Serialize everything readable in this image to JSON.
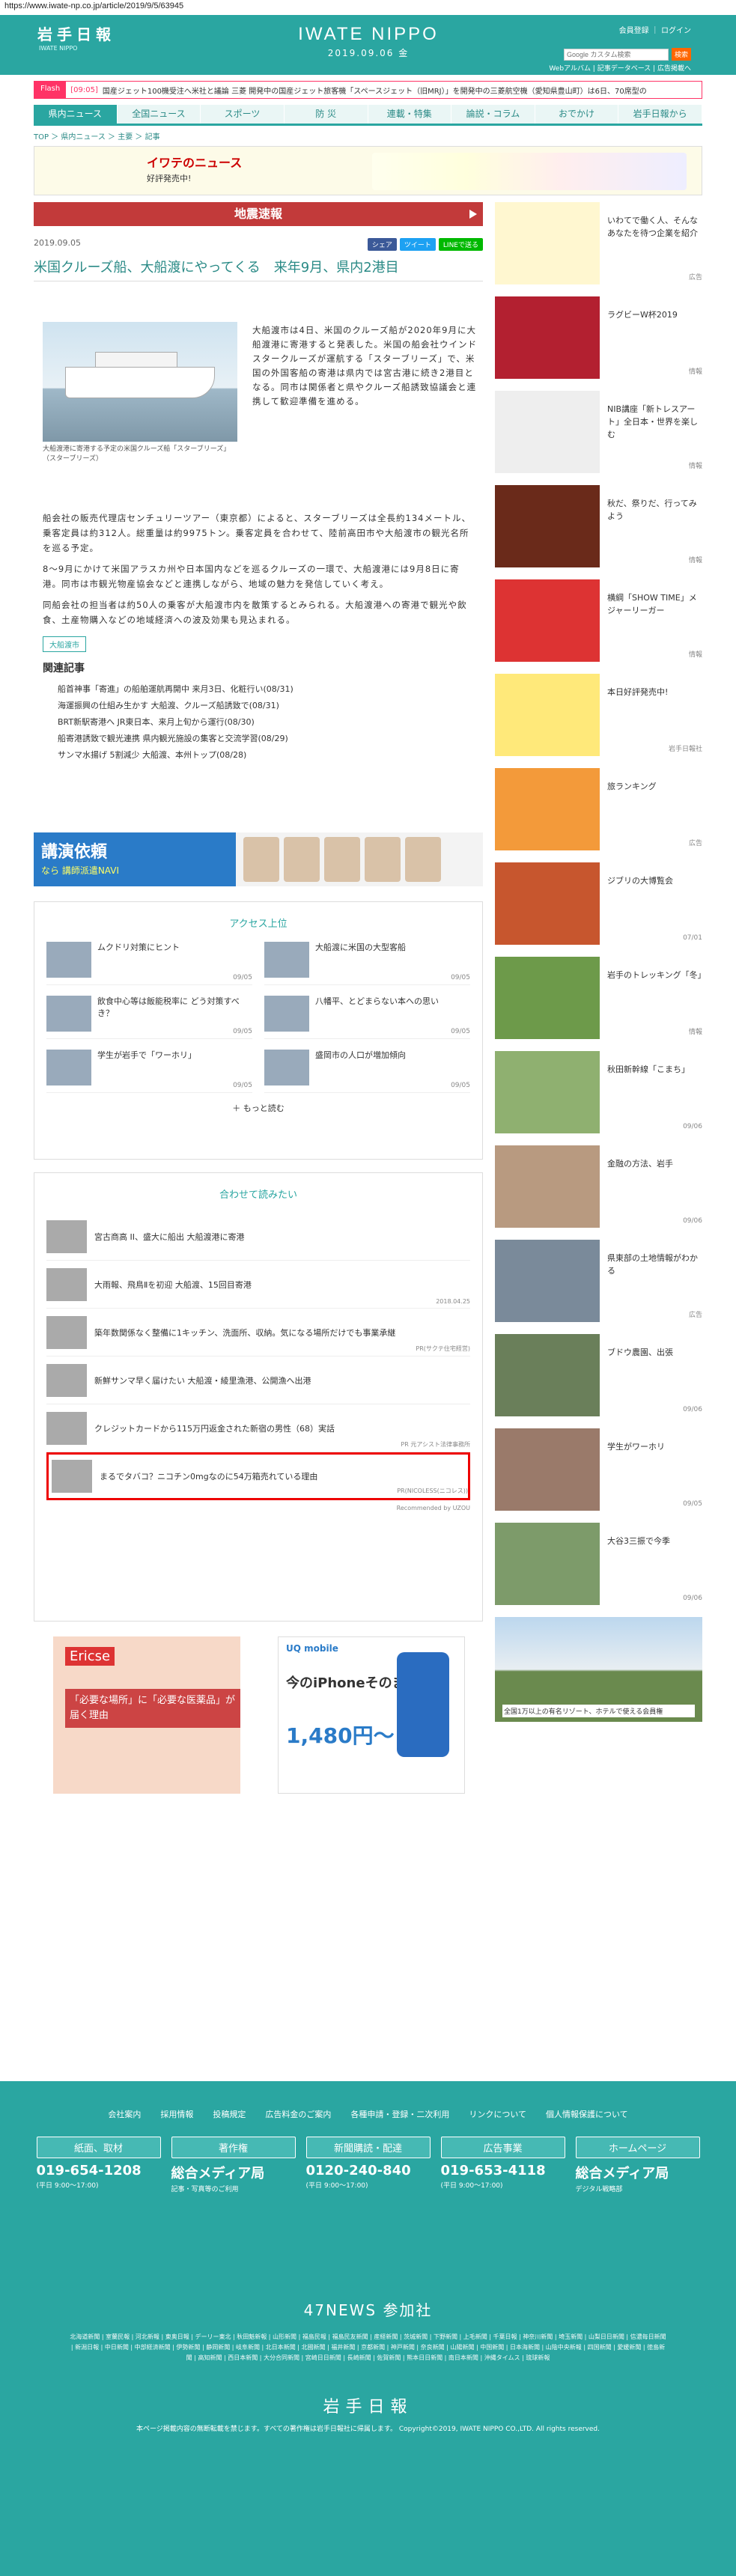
{
  "url": "https://www.iwate-np.co.jp/article/2019/9/5/63945",
  "header": {
    "logo": "岩手日報",
    "logo_sub": "IWATE NIPPO",
    "brand": "IWATE NIPPO",
    "date": "2019.09.06 金",
    "member_link": "会員登録",
    "login_link": "ログイン",
    "search_placeholder": "Google カスタム検索",
    "search_btn": "検索",
    "sub_links": "Webアルバム | 記事データベース | 広告掲載へ"
  },
  "flash": {
    "tag": "Flash",
    "time": "[09:05]",
    "text": "国産ジェット100機受注へ米社と議論 三菱 開発中の国産ジェット旅客機「スペースジェット（旧MRJ）」を開発中の三菱航空機（愛知県豊山町）は6日、70席型の"
  },
  "nav": [
    "県内ニュース",
    "全国ニュース",
    "スポーツ",
    "防 災",
    "連載・特集",
    "論説・コラム",
    "おでかけ",
    "岩手日報から"
  ],
  "breadcrumb": "TOP ＞ 県内ニュース ＞ 主要 ＞ 記事",
  "promo": {
    "title": "イワテのニュース",
    "sub": "好評発売中!"
  },
  "quake": "地震速報",
  "article": {
    "date": "2019.09.05",
    "share": "シェア",
    "tweet": "ツイート",
    "line": "LINEで送る",
    "title": "米国クルーズ船、大船渡にやってくる　来年9月、県内2港目",
    "caption": "大船渡港に寄港する予定の米国クルーズ船「スターブリーズ」（スターブリーズ）",
    "p1": "大船渡市は4日、米国のクルーズ船が2020年9月に大船渡港に寄港すると発表した。米国の船会社ウインドスタークルーズが運航する「スターブリーズ」で、米国の外国客船の寄港は県内では宮古港に続き2港目となる。同市は関係者と県やクルーズ船誘致協議会と連携して歓迎準備を進める。",
    "p2": "船会社の販売代理店センチュリーツアー（東京都）によると、スターブリーズは全長約134メートル、乗客定員は約312人。総重量は約9975トン。乗客定員を合わせて、陸前高田市や大船渡市の観光名所を巡る予定。",
    "p3": "8～9月にかけて米国アラスカ州や日本国内などを巡るクルーズの一環で、大船渡港には9月8日に寄港。同市は市観光物産協会などと連携しながら、地域の魅力を発信していく考え。",
    "p4": "同船会社の担当者は約50人の乗客が大船渡市内を散策するとみられる。大船渡港への寄港で観光や飲食、土産物購入などの地域経済への波及効果も見込まれる。",
    "tag": "大船渡市",
    "related_h": "関連記事",
    "related": [
      "船首神事「寄進」の船舶運航再開中 来月3日、化粧行い(08/31)",
      "海運振興の仕組み生かす 大船渡、クルーズ船誘致で(08/31)",
      "BRT新駅寄港へ JR東日本、来月上旬から運行(08/30)",
      "船寄港誘致で観光連携 県内観光施設の集客と交流学習(08/29)",
      "サンマ水揚げ 5割減少 大船渡、本州トップ(08/28)"
    ]
  },
  "banner": {
    "t1": "講演依頼",
    "t2": "なら 講師派遣NAVI"
  },
  "access": {
    "title": "アクセス上位",
    "items": [
      {
        "t": "ムクドリ対策にヒント",
        "d": "09/05"
      },
      {
        "t": "大船渡に米国の大型客船",
        "d": "09/05"
      },
      {
        "t": "飲食中心等は飯能税率に どう対策すべき？",
        "d": "09/05"
      },
      {
        "t": "八幡平、とどまらない本への思い",
        "d": "09/05"
      },
      {
        "t": "学生が岩手で「ワーホリ」",
        "d": "09/05"
      },
      {
        "t": "盛岡市の人口が増加傾向",
        "d": "09/05"
      }
    ],
    "more": "もっと読む"
  },
  "recs": {
    "title": "合わせて読みたい",
    "items": [
      {
        "t": "宮古商高 II、盛大に船出 大船渡港に寄港",
        "s": ""
      },
      {
        "t": "大雨報、飛鳥Ⅱを初迎 大船渡、15回目寄港",
        "s": "2018.04.25"
      },
      {
        "t": "築年数関係なく整備に1キッチン、洗面所、収納。気になる場所だけでも事業承継",
        "s": "PR(サクテ住宅経営)"
      },
      {
        "t": "新鮮サンマ早く届けたい 大船渡・綾里漁港、公開漁へ出港",
        "s": ""
      },
      {
        "t": "クレジットカードから115万円返金された新宿の男性（68）実話",
        "s": "PR 元アシスト法律事務所"
      },
      {
        "t": "まるでタバコ？ニコチン0mgなのに54万箱売れている理由",
        "s": "PR(NICOLESS(ニコレス))"
      }
    ],
    "powered": "Recommended by UZOU"
  },
  "adA": {
    "t": "Ericse",
    "b": "「必要な場所」に「必要な医薬品」が届く理由"
  },
  "adB": {
    "t": "UQ mobile",
    "h": "今のiPhoneそのままで",
    "p": "1,480円～"
  },
  "side": [
    {
      "t": "いわてで働く人、そんなあなたを待つ企業を紹介",
      "d": "広告"
    },
    {
      "t": "ラグビーW杯2019",
      "d": "情報"
    },
    {
      "t": "NIB講座「新トレスアート」全日本・世界を楽しむ",
      "d": "情報"
    },
    {
      "t": "秋だ、祭りだ、行ってみよう",
      "d": "情報"
    },
    {
      "t": "横綱「SHOW TIME」メジャーリーガー",
      "d": "情報"
    },
    {
      "t": "本日好評発売中!",
      "d": "岩手日報社"
    },
    {
      "t": "旅ランキング",
      "d": "広告"
    },
    {
      "t": "ジブリの大博覧会",
      "d": "07/01"
    },
    {
      "t": "岩手のトレッキング「冬」",
      "d": "情報"
    },
    {
      "t": "秋田新幹線「こまち」",
      "d": "09/06"
    },
    {
      "t": "金融の方法、岩手",
      "d": "09/06"
    },
    {
      "t": "県東部の土地情報がわかる",
      "d": "広告"
    },
    {
      "t": "ブドウ農園、出張",
      "d": "09/06"
    },
    {
      "t": "学生がワーホリ",
      "d": "09/05"
    },
    {
      "t": "大谷3三振で今季",
      "d": "09/06"
    }
  ],
  "side_ad": "全国1万以上の有名リゾート、ホテルで使える会員権",
  "footer": {
    "links": [
      "会社案内",
      "採用情報",
      "投稿規定",
      "広告料金のご案内",
      "各種申請・登録・二次利用",
      "リンクについて",
      "個人情報保護について"
    ],
    "cols": [
      {
        "h": "紙面、取材",
        "n": "019-654-1208",
        "s": "(平日 9:00～17:00)"
      },
      {
        "h": "著作権",
        "n": "総合メディア局",
        "s": "記事・写真等のご利用"
      },
      {
        "h": "新聞購読・配達",
        "n": "0120-240-840",
        "s": "(平日 9:00～17:00)"
      },
      {
        "h": "広告事業",
        "n": "019-653-4118",
        "s": "(平日 9:00～17:00)"
      },
      {
        "h": "ホームページ",
        "n": "総合メディア局",
        "s": "デジタル戦略部"
      }
    ],
    "n47": "47NEWS 参加社",
    "partners": "北海道新聞 | 室蘭民報 | 河北新報 | 東奥日報 | デーリー東北 | 秋田魁新報 | 山形新聞 | 福島民報 | 福島民友新聞 | 産経新聞 | 茨城新聞 | 下野新聞 | 上毛新聞 | 千葉日報 | 神奈川新聞 | 埼玉新聞 | 山梨日日新聞 | 信濃毎日新聞 | 新潟日報 | 中日新聞 | 中部経済新聞 | 伊勢新聞 | 静岡新聞 | 岐阜新聞 | 北日本新聞 | 北國新聞 | 福井新聞 | 京都新聞 | 神戸新聞 | 奈良新聞 | 山陽新聞 | 中国新聞 | 日本海新聞 | 山陰中央新報 | 四国新聞 | 愛媛新聞 | 徳島新聞 | 高知新聞 | 西日本新聞 | 大分合同新聞 | 宮崎日日新聞 | 長崎新聞 | 佐賀新聞 | 熊本日日新聞 | 南日本新聞 | 沖縄タイムス | 琉球新報",
    "logo": "岩手日報",
    "copy": "本ページ掲載内容の無断転載を禁じます。すべての著作権は岩手日報社に帰属します。 Copyright©2019, IWATE NIPPO CO.,LTD. All rights reserved."
  },
  "colors": {
    "teal": "#2aa6a1",
    "red": "#c23a3a"
  }
}
